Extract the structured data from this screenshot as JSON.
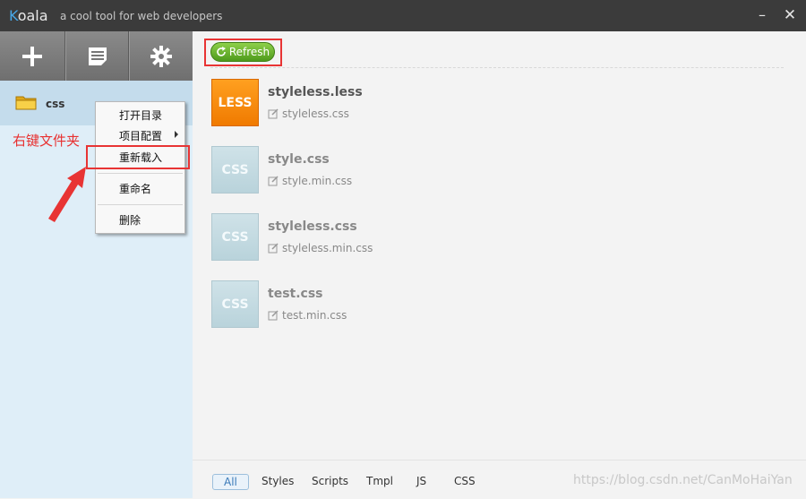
{
  "titlebar": {
    "brand_k": "K",
    "brand_rest": "oala",
    "tagline": "a cool tool for web developers",
    "minimize": "–",
    "close": "✕"
  },
  "sidebar": {
    "toolbar": [
      {
        "icon": "plus-icon"
      },
      {
        "icon": "document-icon"
      },
      {
        "icon": "gear-icon"
      }
    ],
    "folder": {
      "name": "css",
      "icon": "folder-icon"
    }
  },
  "annotation": {
    "text": "右键文件夹",
    "color": "#e83030"
  },
  "context_menu": {
    "items": [
      "打开目录",
      "项目配置",
      "重新载入",
      "重命名",
      "删除"
    ]
  },
  "main": {
    "refresh_label": "Refresh",
    "files": [
      {
        "name": "styleless.less",
        "type": "LESS",
        "output": "styleless.css"
      },
      {
        "name": "style.css",
        "type": "CSS",
        "output": "style.min.css"
      },
      {
        "name": "styleless.css",
        "type": "CSS",
        "output": "styleless.min.css"
      },
      {
        "name": "test.css",
        "type": "CSS",
        "output": "test.min.css"
      }
    ]
  },
  "tabs": [
    "All",
    "Styles",
    "Scripts",
    "Tmpl",
    "JS",
    "CSS"
  ],
  "active_tab": "All",
  "watermark": "https://blog.csdn.net/CanMoHaiYan",
  "colors": {
    "accent_green": "#5aa823",
    "less_orange": "#f58a0b",
    "annotation_red": "#e83434"
  }
}
